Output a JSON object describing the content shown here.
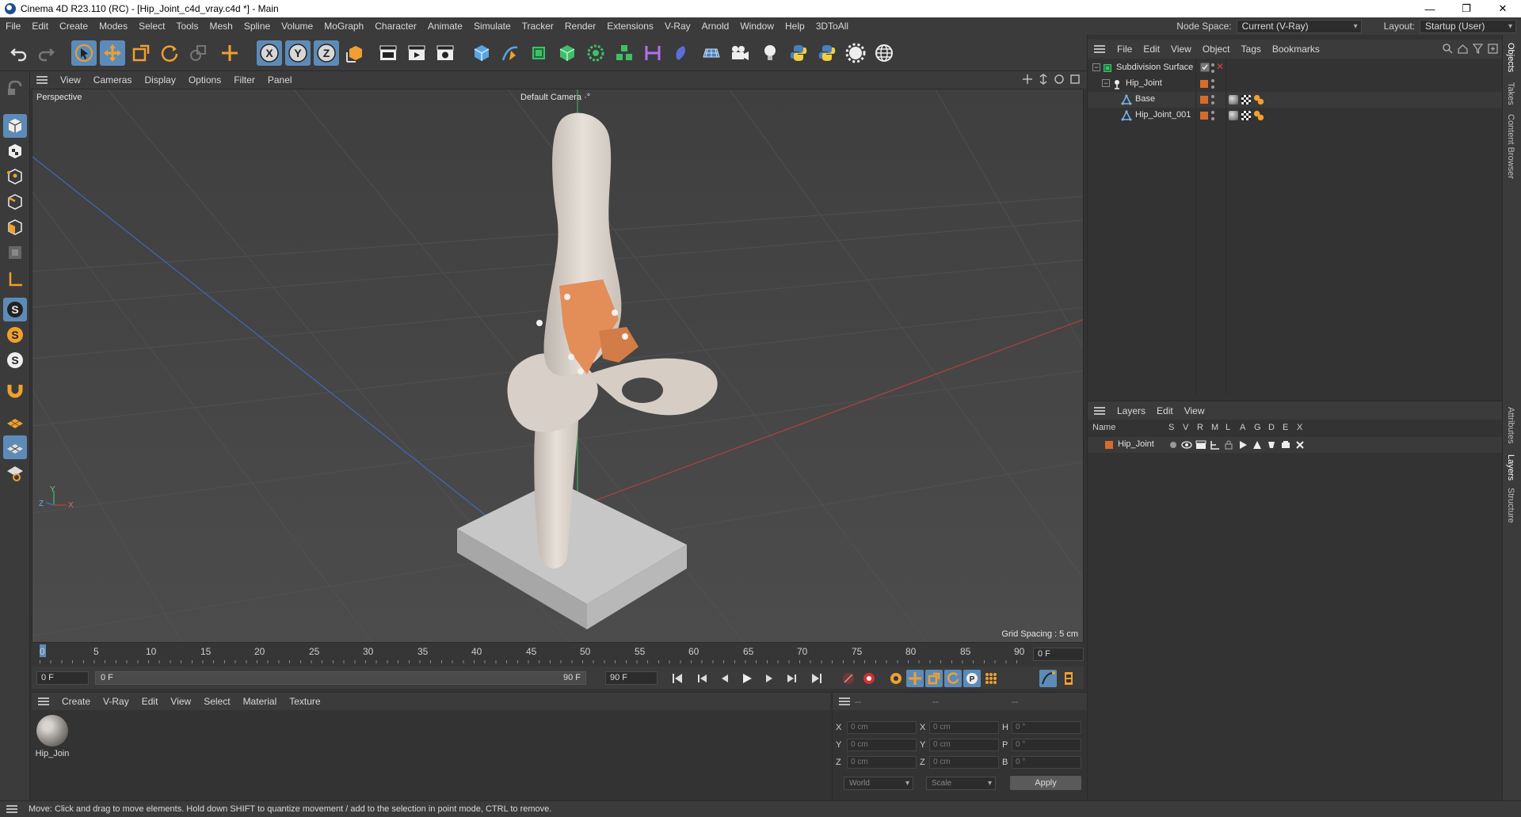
{
  "window": {
    "title": "Cinema 4D R23.110 (RC) - [Hip_Joint_c4d_vray.c4d *] - Main",
    "controls": [
      "—",
      "❐",
      "✕"
    ]
  },
  "menubar": {
    "items": [
      "File",
      "Edit",
      "Create",
      "Modes",
      "Select",
      "Tools",
      "Mesh",
      "Spline",
      "Volume",
      "MoGraph",
      "Character",
      "Animate",
      "Simulate",
      "Tracker",
      "Render",
      "Extensions",
      "V-Ray",
      "Arnold",
      "Window",
      "Help",
      "3DToAll"
    ],
    "node_space_label": "Node Space:",
    "node_space_value": "Current (V-Ray)",
    "layout_label": "Layout:",
    "layout_value": "Startup (User)"
  },
  "toolbar": {
    "axis_x": "X",
    "axis_y": "Y",
    "axis_z": "Z"
  },
  "viewport_menu": {
    "items": [
      "View",
      "Cameras",
      "Display",
      "Options",
      "Filter",
      "Panel"
    ]
  },
  "viewport": {
    "view_name": "Perspective",
    "camera": "Default Camera",
    "camera_suffix": "·°",
    "grid_spacing": "Grid Spacing : 5 cm",
    "axis_y": "Y",
    "axis_x": "X",
    "axis_z": "Z"
  },
  "timeline": {
    "ticks": [
      "0",
      "5",
      "10",
      "15",
      "20",
      "25",
      "30",
      "35",
      "40",
      "45",
      "50",
      "55",
      "60",
      "65",
      "70",
      "75",
      "80",
      "85",
      "90"
    ],
    "current_frame": "0 F",
    "start_frame": "0 F",
    "range_start": "0 F",
    "range_end": "90 F",
    "end_frame": "90 F"
  },
  "material_manager": {
    "menu": [
      "Create",
      "V-Ray",
      "Edit",
      "View",
      "Select",
      "Material",
      "Texture"
    ],
    "materials": [
      {
        "name": "Hip_Join"
      }
    ]
  },
  "coordinates": {
    "headers": [
      "--",
      "--",
      "--"
    ],
    "rows": [
      {
        "l1": "X",
        "v1": "0 cm",
        "l2": "X",
        "v2": "0 cm",
        "l3": "H",
        "v3": "0 °"
      },
      {
        "l1": "Y",
        "v1": "0 cm",
        "l2": "Y",
        "v2": "0 cm",
        "l3": "P",
        "v3": "0 °"
      },
      {
        "l1": "Z",
        "v1": "0 cm",
        "l2": "Z",
        "v2": "0 cm",
        "l3": "B",
        "v3": "0 °"
      }
    ],
    "space": "World",
    "mode": "Scale",
    "apply": "Apply"
  },
  "objects_panel": {
    "menu": [
      "File",
      "Edit",
      "View",
      "Object",
      "Tags",
      "Bookmarks"
    ],
    "tree": [
      {
        "name": "Subdivision Surface",
        "depth": 0
      },
      {
        "name": "Hip_Joint",
        "depth": 1
      },
      {
        "name": "Base",
        "depth": 2
      },
      {
        "name": "Hip_Joint_001",
        "depth": 2
      }
    ]
  },
  "layers_panel": {
    "menu": [
      "Layers",
      "Edit",
      "View"
    ],
    "columns": [
      "Name",
      "S",
      "V",
      "R",
      "M",
      "L",
      "A",
      "G",
      "D",
      "E",
      "X"
    ],
    "layers": [
      {
        "name": "Hip_Joint"
      }
    ]
  },
  "side_tabs": [
    "Objects",
    "Takes",
    "Content Browser",
    "Attributes",
    "Layers",
    "Structure"
  ],
  "status": {
    "text": "Move: Click and drag to move elements. Hold down SHIFT to quantize movement / add to the selection in point mode, CTRL to remove."
  },
  "colors": {
    "accent": "#5d8bb8",
    "layer_color": "#d76b2c",
    "viewport_bg": "#474747"
  }
}
